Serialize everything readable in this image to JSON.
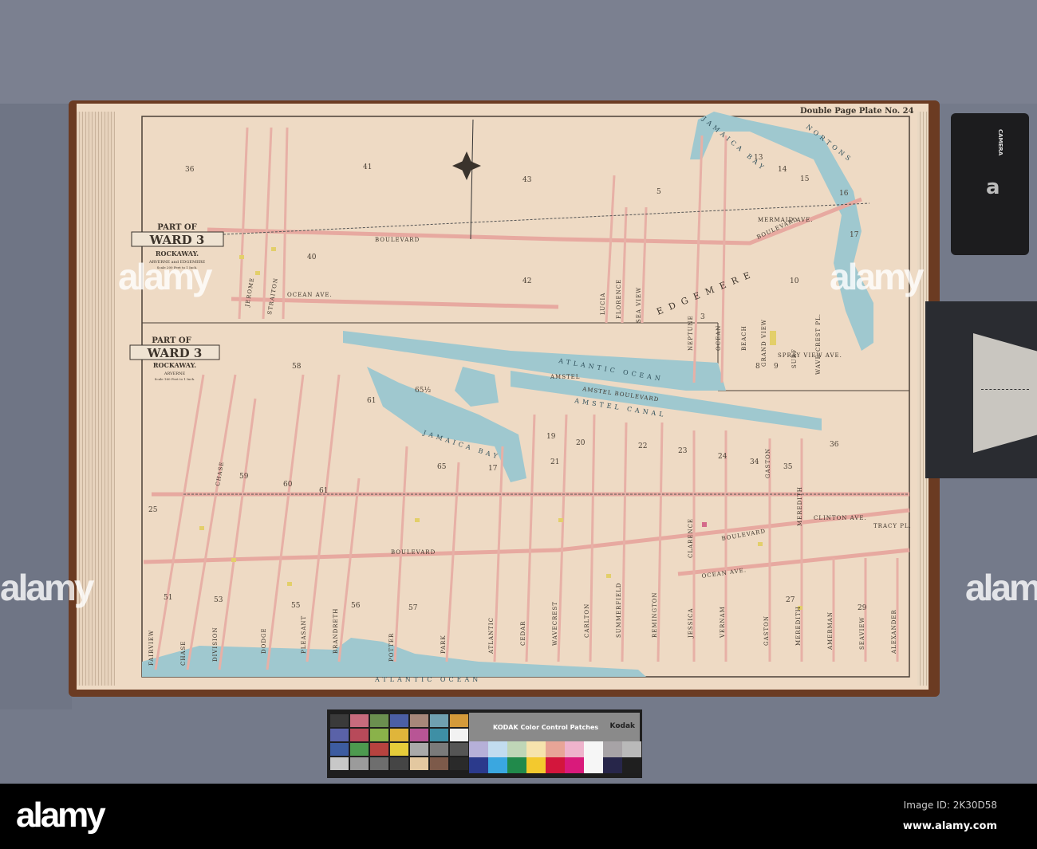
{
  "plate_title": "Double Page Plate No. 24",
  "cartouche_upper": {
    "line1": "PART OF",
    "line2": "WARD 3",
    "line3": "ROCKAWAY.",
    "line4": "ARVERNE and EDGEMERE",
    "scale": "Scale 200 Feet to 1 Inch."
  },
  "cartouche_lower": {
    "line1": "PART OF",
    "line2": "WARD 3",
    "line3": "ROCKAWAY.",
    "line4": "ARVERNE",
    "scale": "Scale 160 Feet to 1 Inch."
  },
  "water_labels": [
    "ATLANTIC OCEAN",
    "AMSTEL CANAL",
    "JAMAICA BAY",
    "JAMAICA BAY",
    "NORTONS",
    "ATLANTIC OCEAN"
  ],
  "streets": [
    "BOULEVARD",
    "OCEAN AVE.",
    "AMSTEL BOULEVARD",
    "BOULEVARD",
    "MERMAID AVE.",
    "SPRAY VIEW AVE.",
    "EDGEMERE",
    "BOULEVARD",
    "OCEAN AVE.",
    "CLINTON AVE.",
    "TRACY PL.",
    "BOULEVARD",
    "AMSTEL"
  ],
  "avenues_lower": [
    "FAIRVIEW",
    "CHASE",
    "DIVISION",
    "DODGE",
    "PLEASANT",
    "BRANDRETH",
    "POTTER",
    "PARK",
    "ATLANTIC",
    "CEDAR",
    "WAVECREST",
    "CARLTON",
    "SUMMERFIELD",
    "REMINGTON",
    "JESSICA",
    "VERNAM",
    "GASTON",
    "MEREDITH",
    "AMERMAN",
    "SEAVIEW",
    "ALEXANDER"
  ],
  "avenues_upper": [
    "LUCIA",
    "FLORENCE",
    "SEA VIEW",
    "NEPTUNE",
    "OCEAN",
    "BEACH",
    "GRAND VIEW",
    "SURF",
    "WAVE CREST PL.",
    "JEROME",
    "STRAITON",
    "CHASE",
    "CLARENCE",
    "GASTON",
    "MEREDITH"
  ],
  "lots": [
    "41",
    "43",
    "36",
    "40",
    "42",
    "5",
    "13",
    "14",
    "15",
    "16",
    "17",
    "10",
    "8",
    "9",
    "58",
    "61",
    "65½",
    "19",
    "20",
    "21",
    "22",
    "23",
    "24",
    "34",
    "35",
    "36",
    "59",
    "60",
    "61",
    "57",
    "51",
    "53",
    "55",
    "56",
    "27",
    "29",
    "65",
    "17",
    "3",
    "25"
  ],
  "kodak": {
    "title": "KODAK Color Control Patches",
    "brand": "Kodak"
  },
  "camera_label": "CAMERA",
  "watermark": "alamy",
  "footer": {
    "logo": "alamy",
    "image_id": "Image ID: 2K30D58",
    "url": "www.alamy.com"
  }
}
